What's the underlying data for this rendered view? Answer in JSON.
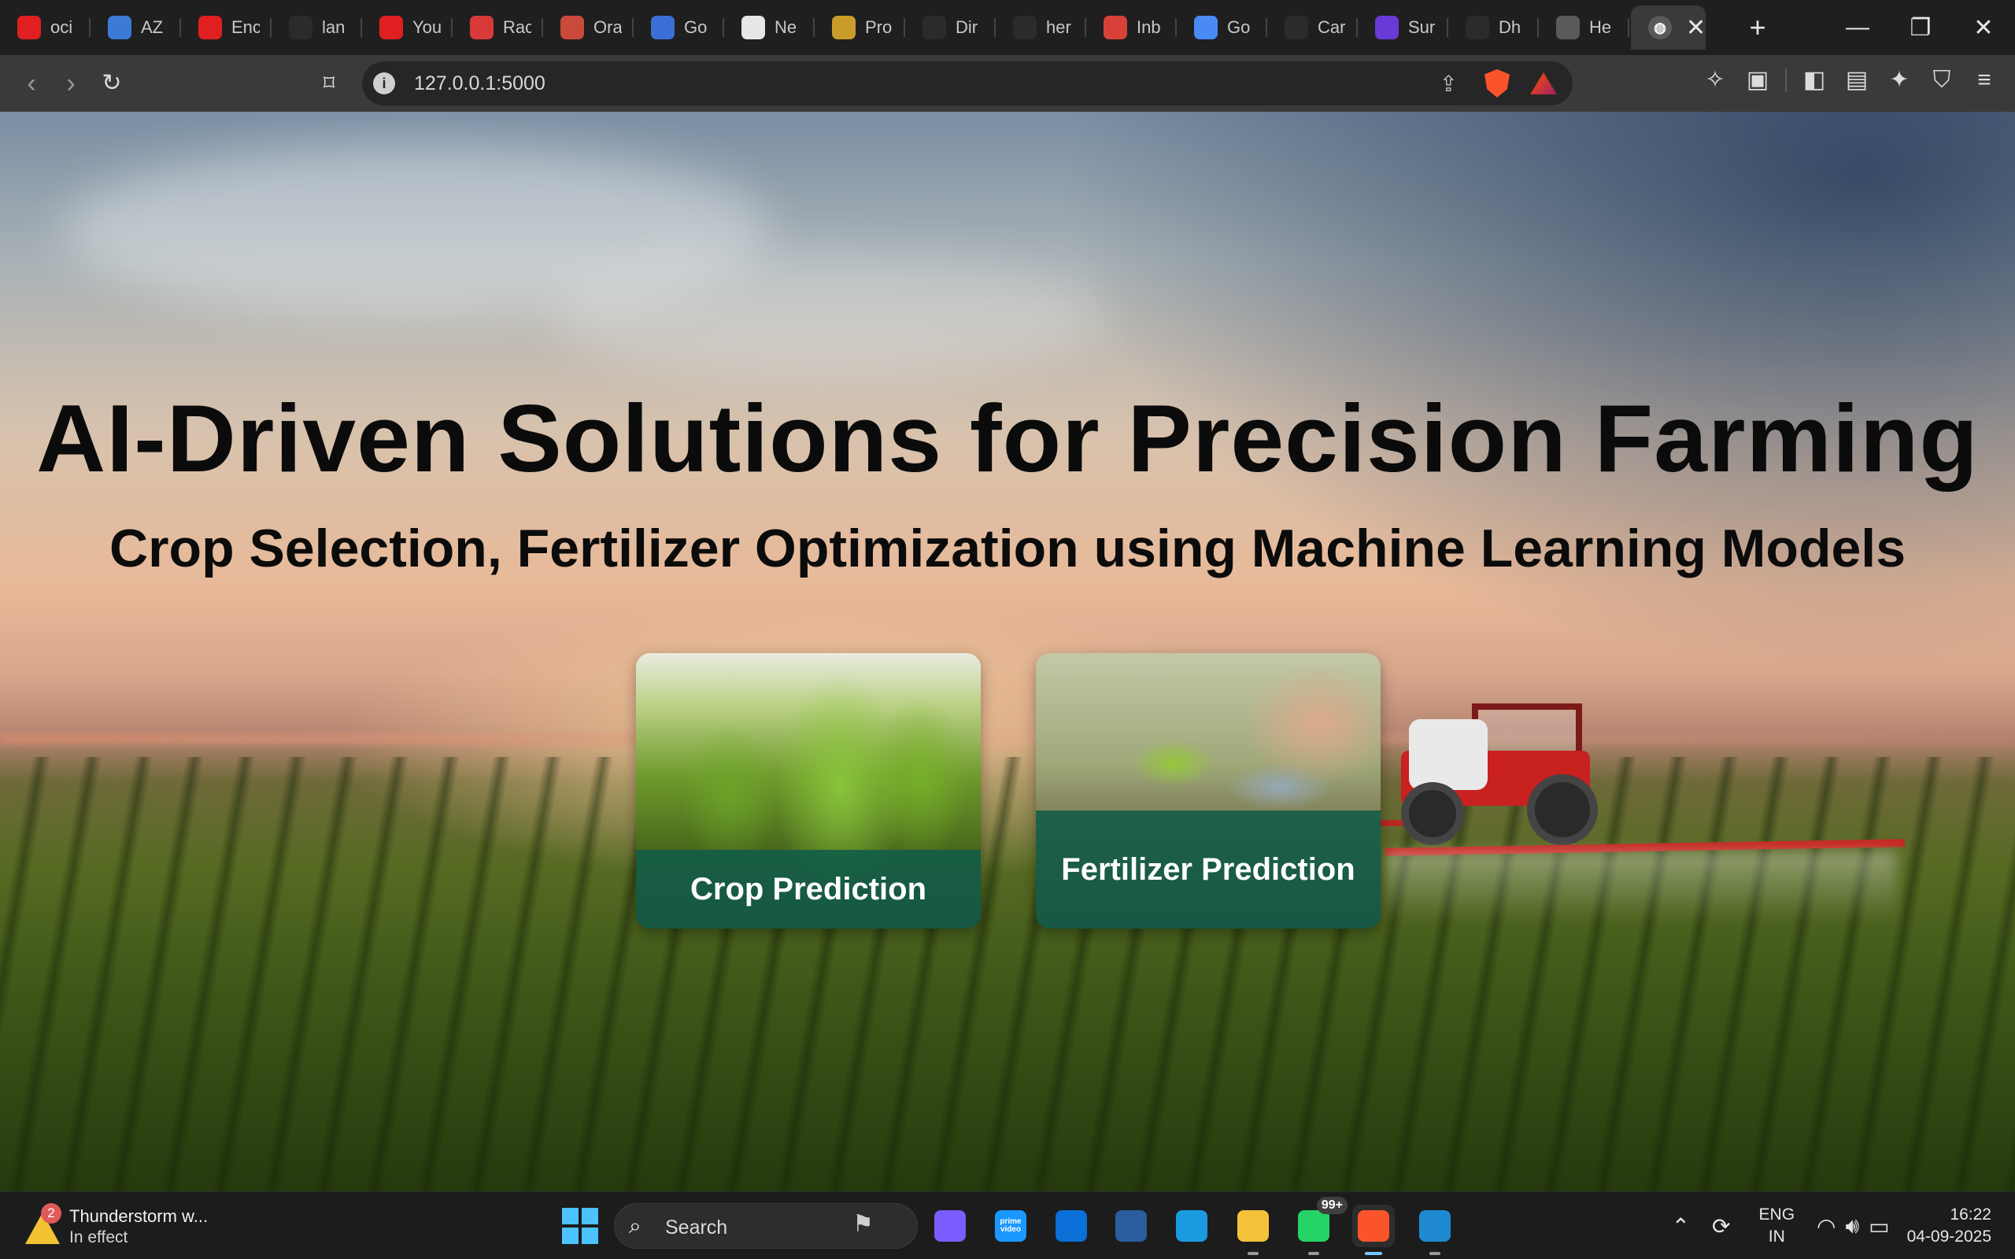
{
  "browser": {
    "tabs": [
      {
        "title": "oci",
        "icon": "youtube-icon",
        "color": "#e02020"
      },
      {
        "title": "AZ",
        "icon": "azure-devops-icon",
        "color": "#3b7bd6"
      },
      {
        "title": "Enc",
        "icon": "youtube-icon",
        "color": "#e02020"
      },
      {
        "title": "lan",
        "icon": "github-icon",
        "color": "#2b2b2b"
      },
      {
        "title": "You",
        "icon": "youtube-icon",
        "color": "#e02020"
      },
      {
        "title": "Rac",
        "icon": "oracle-icon",
        "color": "#d83a3a"
      },
      {
        "title": "Ora",
        "icon": "oracle-icon",
        "color": "#c94a3a"
      },
      {
        "title": "Go",
        "icon": "google-groups-icon",
        "color": "#3b6fd6"
      },
      {
        "title": "Ne",
        "icon": "rocket-icon",
        "color": "#e6e6e6"
      },
      {
        "title": "Pro",
        "icon": "prompt-icon",
        "color": "#c99b2a"
      },
      {
        "title": "Dir",
        "icon": "github-icon",
        "color": "#2b2b2b"
      },
      {
        "title": "her",
        "icon": "github-icon",
        "color": "#2b2b2b"
      },
      {
        "title": "Inb",
        "icon": "gmail-icon",
        "color": "#d64238"
      },
      {
        "title": "Go",
        "icon": "gemini-icon",
        "color": "#4a8af4"
      },
      {
        "title": "Car",
        "icon": "openai-icon",
        "color": "#2b2b2b"
      },
      {
        "title": "Sur",
        "icon": "surfshark-icon",
        "color": "#6a3ad6"
      },
      {
        "title": "Dh",
        "icon": "github-icon",
        "color": "#2b2b2b"
      },
      {
        "title": "He",
        "icon": "globe-icon",
        "color": "#5a5a5a"
      }
    ],
    "active_tab": {
      "icon": "globe-icon",
      "close": "✕"
    },
    "new_tab": "+",
    "url": "127.0.0.1:5000"
  },
  "page": {
    "title": "AI-Driven Solutions for Precision Farming",
    "subtitle": "Crop Selection, Fertilizer Optimization using Machine Learning Models",
    "cards": {
      "crop": {
        "label": "Crop Prediction"
      },
      "fertilizer": {
        "label": "Fertilizer Prediction"
      }
    }
  },
  "taskbar": {
    "weather": {
      "badge": "2",
      "title": "Thunderstorm w...",
      "status": "In effect"
    },
    "search_placeholder": "Search",
    "apps": [
      {
        "name": "copilot",
        "color": "#7b5cff"
      },
      {
        "name": "prime-video",
        "color": "#1a98ff",
        "label": "prime video"
      },
      {
        "name": "microsoft-store",
        "color": "#0a6fd6"
      },
      {
        "name": "mysql-workbench",
        "color": "#2a5d9e"
      },
      {
        "name": "edge",
        "color": "#1a9be0"
      },
      {
        "name": "file-explorer",
        "color": "#f4c23a"
      },
      {
        "name": "whatsapp",
        "color": "#25d366",
        "badge": "99+"
      },
      {
        "name": "brave",
        "color": "#fb542b"
      },
      {
        "name": "vscode",
        "color": "#1f8ad2"
      }
    ],
    "lang": {
      "line1": "ENG",
      "line2": "IN"
    },
    "time": "16:22",
    "date": "04-09-2025"
  }
}
